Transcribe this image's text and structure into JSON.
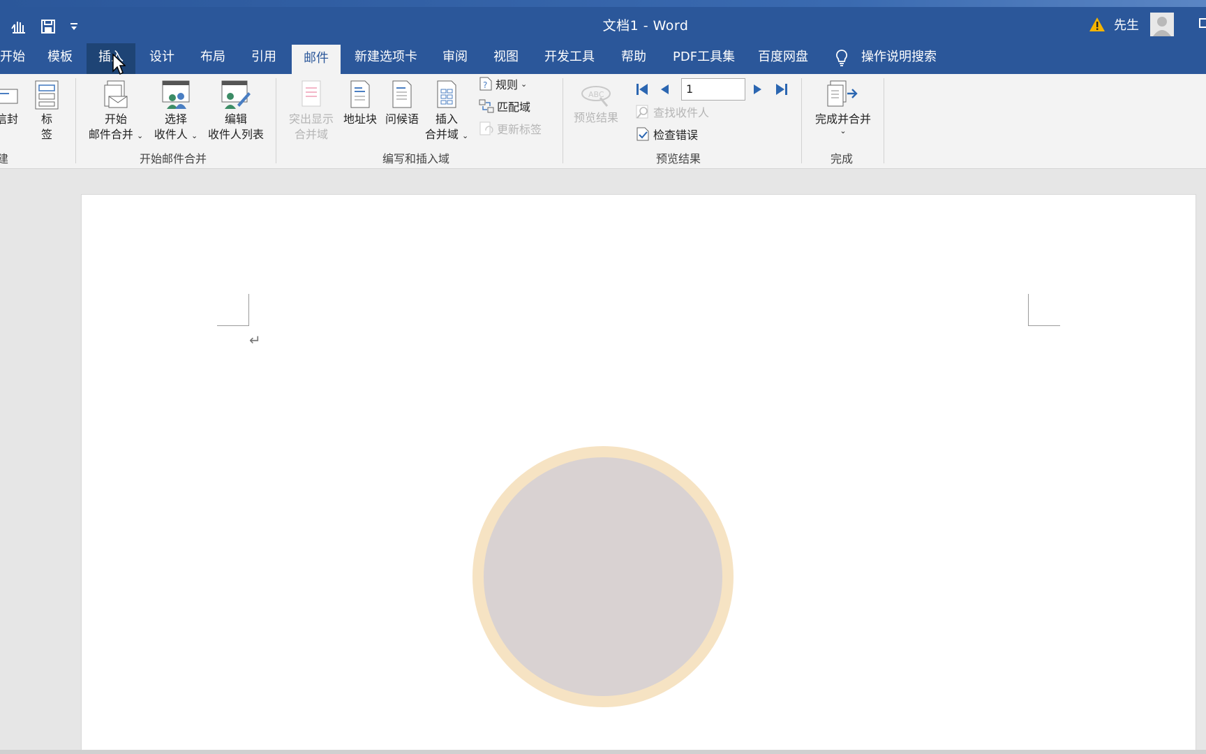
{
  "title_bar": {
    "document_title": "文档1  -  Word",
    "user_name": "先生",
    "qat_icons": [
      "touch-mode-icon",
      "save-icon",
      "customize-qat-icon"
    ]
  },
  "tabs": [
    {
      "label": "开始",
      "state": "normal"
    },
    {
      "label": "模板",
      "state": "normal"
    },
    {
      "label": "插入",
      "state": "hover"
    },
    {
      "label": "设计",
      "state": "normal"
    },
    {
      "label": "布局",
      "state": "normal"
    },
    {
      "label": "引用",
      "state": "normal"
    },
    {
      "label": "邮件",
      "state": "active"
    },
    {
      "label": "新建选项卡",
      "state": "normal"
    },
    {
      "label": "审阅",
      "state": "normal"
    },
    {
      "label": "视图",
      "state": "normal"
    },
    {
      "label": "开发工具",
      "state": "normal"
    },
    {
      "label": "帮助",
      "state": "normal"
    },
    {
      "label": "PDF工具集",
      "state": "normal"
    },
    {
      "label": "百度网盘",
      "state": "normal"
    },
    {
      "label": "操作说明搜索",
      "state": "search"
    }
  ],
  "ribbon": {
    "create_group": {
      "label": "建",
      "envelope_label": "信封",
      "labels_label_line1": "标",
      "labels_label_line2": "签"
    },
    "start_group": {
      "label": "开始邮件合并",
      "start_merge_line1": "开始",
      "start_merge_line2": "邮件合并",
      "select_recipients_line1": "选择",
      "select_recipients_line2": "收件人",
      "edit_list_line1": "编辑",
      "edit_list_line2": "收件人列表"
    },
    "write_group": {
      "label": "编写和插入域",
      "highlight_line1": "突出显示",
      "highlight_line2": "合并域",
      "address_block": "地址块",
      "greeting_line": "问候语",
      "insert_field_line1": "插入",
      "insert_field_line2": "合并域",
      "rules": "规则",
      "match_fields": "匹配域",
      "update_labels": "更新标签"
    },
    "preview_group": {
      "label": "预览结果",
      "preview_results": "预览结果",
      "record_value": "1",
      "find_recipient": "查找收件人",
      "check_errors": "检查错误"
    },
    "finish_group": {
      "label": "完成",
      "finish_merge": "完成并合并"
    }
  },
  "document": {
    "paragraph_mark": "↵"
  },
  "colors": {
    "word_blue": "#2b579a",
    "ribbon_bg": "#f3f3f3",
    "disabled_text": "#b5b5b5"
  }
}
